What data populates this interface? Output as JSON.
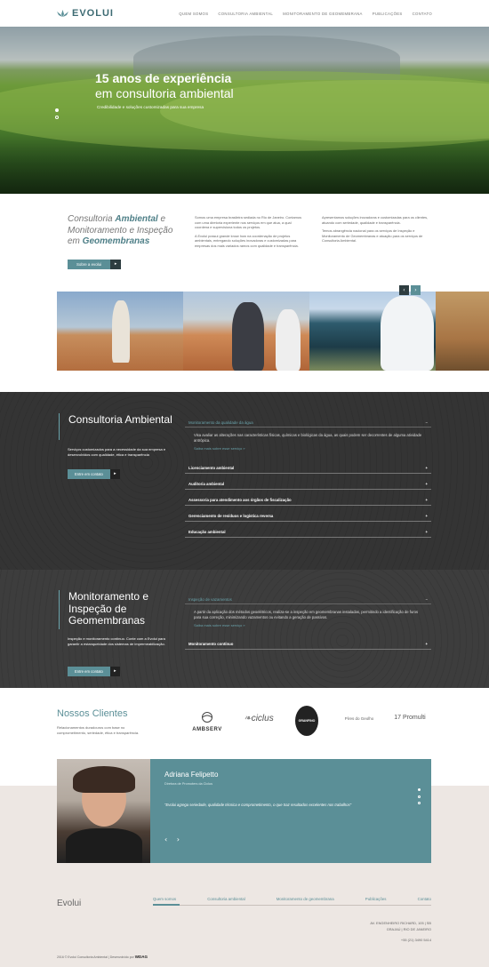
{
  "header": {
    "logo": "EVOLUI",
    "nav": [
      "QUEM SOMOS",
      "CONSULTORIA AMBIENTAL",
      "MONITORAMENTO DE GEOMEMBRANA",
      "PUBLICAÇÕES",
      "CONTATO"
    ]
  },
  "hero": {
    "title_line1": "15 anos de experiência",
    "title_line2": "em consultoria ambiental",
    "subtitle": "Credibilidade e soluções customizadas para sua empresa"
  },
  "intro": {
    "title_part1": "Consultoria ",
    "title_bold1": "Ambiental",
    "title_part2": " e Monitoramento e Inspeção em ",
    "title_bold2": "Geomembranas",
    "button_label": "Sobre a evolui",
    "col1_p1": "Somos uma empresa brasileira sediada no Rio de Janeiro. Contamos com uma diretoria experiente nos serviços em que atua, a qual coordena e supervisiona todos os projetos.",
    "col1_p2": "A Evolui possui grande know how na coordenação de projetos ambientais, entregando soluções inovadoras e customizadas para empresas dos mais variados ramos com qualidade e transparência.",
    "col2_p1": "Apresentamos soluções inovadoras e customizadas para os clientes, atuando com seriedade, qualidade e transparência.",
    "col2_p2": "Temos abrangência nacional para os serviços de Inspeção e Monitoramento de Geomembranas e atuação para os serviços de Consultoria Ambiental."
  },
  "consultoria": {
    "title": "Consultoria Ambiental",
    "description": "Serviços customizados para a necessidade da sua empresa e desenvolvidos com qualidade, ética e transparência",
    "button_label": "Entre em contato",
    "open_item": {
      "label": "Monitoramento da qualidade da água",
      "body": "Visa avaliar as alterações nas características físicas, químicas e biológicas da água, as quais podem ser decorrentes de alguma atividade antrópica.",
      "link": "Saiba mais sobre esse serviço »"
    },
    "items": [
      "Licenciamento ambiental",
      "Auditoria ambiental",
      "Assessoria para atendimento aos órgãos de fiscalização",
      "Gerenciamento de resíduos e logística reversa",
      "Educação ambiental"
    ]
  },
  "monitoramento": {
    "title": "Monitoramento e Inspeção de Geomembranas",
    "description": "Inspeção e monitoramento contínuo. Conte com a Evolui para garantir a estanqueidade dos sistemas de impermeabilização.",
    "button_label": "Entre em contato",
    "open_item": {
      "label": "Inspeção de vazamentos",
      "body": "A partir da aplicação dos métodos geoelétricos, realiza-se a inspeção em geomembranas instaladas, permitindo a identificação de furos para sua correção, minimizando vazamentos ou evitando a geração de passivos.",
      "link": "Saiba mais sobre esse serviço »"
    },
    "items": [
      "Monitoramento contínuo"
    ]
  },
  "clientes": {
    "title": "Nossos Clientes",
    "description": "Relacionamentos duradouros com base no comprometimento, seriedade, ética e transparência.",
    "logos": [
      "AMBSERV",
      "ciclus",
      "GRANFINO",
      "Píres do Geolho",
      "Promulti"
    ]
  },
  "testimonial": {
    "name": "Adriana Felipetto",
    "role": "Diretora de Promoters da Ciclus",
    "quote": "\"Evolui agrega seriedade, qualidade técnica e comprometimento, o que traz resultados excelentes nos trabalhos\"",
    "arrows": "‹ ›"
  },
  "footer": {
    "logo": "Evolui",
    "nav": [
      "Quem somos",
      "Consultoria ambiental",
      "Monitoramento de geomembrana",
      "Publicações",
      "Contato"
    ],
    "address1": "AV. ENGENHEIRO RICHARD, 105 | SB",
    "address2": "GRAJAÚ | RIO DE JANEIRO",
    "phone": "+55 (21) 3490 5414",
    "copyright": "2016 © Evolui Consultoria Ambiental | Desenvolvido por",
    "dev": "WDAG"
  }
}
